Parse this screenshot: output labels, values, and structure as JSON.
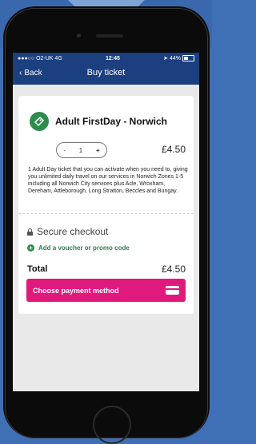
{
  "status": {
    "carrier": "●●●○○ O2-UK  4G",
    "time": "12:45",
    "battery": "44%"
  },
  "nav": {
    "back_label": "Back",
    "title": "Buy ticket"
  },
  "ticket": {
    "name": "Adult FirstDay - Norwich",
    "quantity": "1",
    "minus": "-",
    "plus": "+",
    "price": "£4.50",
    "description": "1 Adult Day ticket that you can activate when you need to, giving you unlimited daily travel on our services in Norwich Zones 1-5 including all Norwich City services plus Acle, Wroxham, Dereham, Attleborough, Long Stratton, Beccles and Bungay."
  },
  "checkout": {
    "heading": "Secure checkout",
    "voucher_link": "Add a voucher or promo code",
    "total_label": "Total",
    "total_amount": "£4.50",
    "pay_button": "Choose payment method"
  },
  "colors": {
    "accent_pink": "#e0197d",
    "accent_green": "#2e8b4e",
    "nav_blue": "#1c3f7f"
  }
}
